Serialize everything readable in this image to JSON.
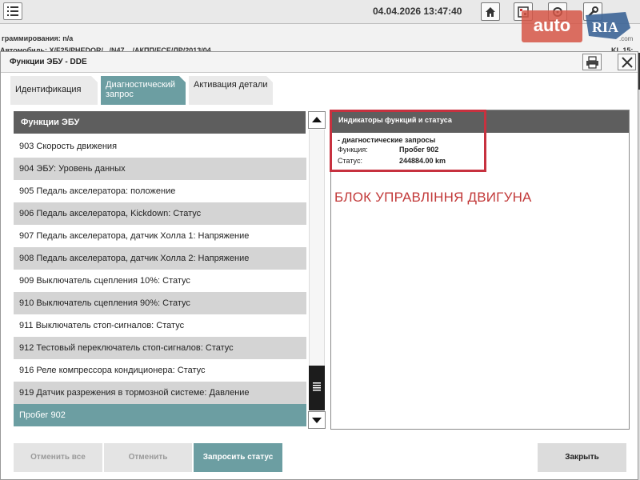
{
  "topbar": {
    "datetime": "04.04.2026 13:47:40"
  },
  "background": {
    "line1": "граммирования:  n/a",
    "line2": "Автомобиль:  X/F25/PHEDOR/.../N47 .../АКПП/ECE/ЛР/2013/04",
    "right": "KL 15:"
  },
  "watermark": {
    "auto": "auto",
    "ria": "RIA",
    "com": ".com"
  },
  "dialog": {
    "title": "Функции ЭБУ - DDE",
    "tabs": [
      {
        "label": "Идентификация"
      },
      {
        "label": "Диагностический запрос"
      },
      {
        "label": "Активация детали"
      }
    ],
    "list_header": "Функции ЭБУ",
    "list_items": [
      {
        "label": "903 Скорость движения"
      },
      {
        "label": "904 ЭБУ: Уровень данных"
      },
      {
        "label": "905 Педаль акселератора: положение"
      },
      {
        "label": "906 Педаль акселератора, Kickdown: Статус"
      },
      {
        "label": "907 Педаль акселератора, датчик Холла 1: Напряжение"
      },
      {
        "label": "908 Педаль акселератора, датчик Холла 2: Напряжение"
      },
      {
        "label": "909 Выключатель сцепления 10%: Статус"
      },
      {
        "label": "910 Выключатель сцепления 90%: Статус"
      },
      {
        "label": "911 Выключатель стоп-сигналов: Статус"
      },
      {
        "label": "912 Тестовый переключатель стоп-сигналов: Статус"
      },
      {
        "label": "916 Реле компрессора кондиционера: Статус"
      },
      {
        "label": "919 Датчик разрежения в тормозной системе: Давление"
      },
      {
        "label": "Пробег 902"
      }
    ],
    "right_panel": {
      "header": "Индикаторы функций и статуса",
      "subheader": "- диагностические запросы",
      "function_label": "Функция:",
      "function_value": "Пробег 902",
      "status_label": "Статус:",
      "status_value": "244884.00  km",
      "annotation": "БЛОК УПРАВЛІННЯ ДВИГУНА"
    },
    "buttons": {
      "cancel_all": "Отменить все",
      "cancel": "Отменить",
      "request_status": "Запросить статус",
      "close": "Закрыть"
    }
  },
  "colors": {
    "accent": "#6c9ea2",
    "header": "#5e5e5e",
    "annotation_red": "#c7313f"
  }
}
